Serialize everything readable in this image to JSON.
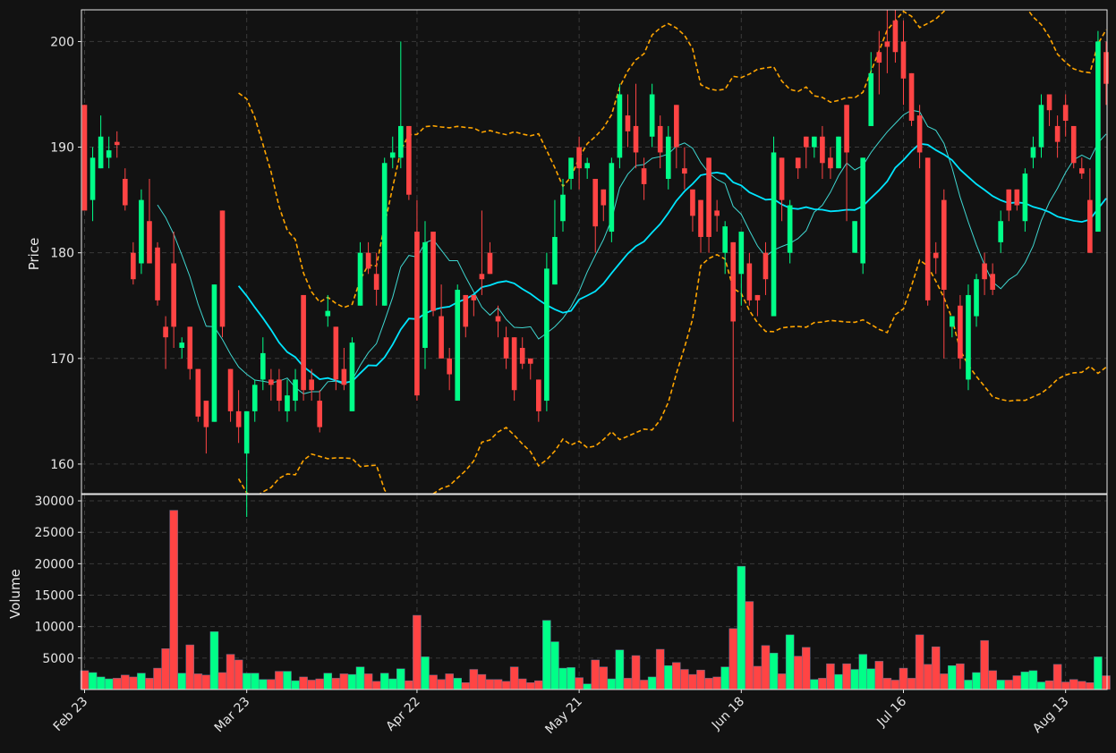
{
  "chart_data": {
    "type": "candlestick",
    "ylabel_price": "Price",
    "ylabel_volume": "Volume",
    "price_ylim": [
      157.2,
      203.0
    ],
    "price_ticks": [
      160,
      170,
      180,
      190,
      200
    ],
    "volume_ylim": [
      0,
      31000
    ],
    "volume_ticks": [
      5000,
      10000,
      15000,
      20000,
      25000,
      30000
    ],
    "x_tick_labels": [
      "Feb 23",
      "Mar 23",
      "Apr 22",
      "May 21",
      "Jun 18",
      "Jul 16",
      "Aug 13"
    ],
    "x_tick_index": [
      0,
      20,
      41,
      61,
      81,
      101,
      121
    ],
    "grid": true,
    "colors": {
      "background": "#121212",
      "up": "#00ff88",
      "down": "#ff4444",
      "sma20": "#00e5ff",
      "sma10": "#3fd6d0",
      "bollinger": "#ffa500",
      "grid": "#3a3a3a",
      "frame": "#e6e6e6"
    },
    "candles": [
      [
        194,
        184,
        194,
        184,
        3000
      ],
      [
        185,
        189,
        190,
        183,
        2700
      ],
      [
        188,
        191,
        193,
        188,
        2000
      ],
      [
        189,
        189.7,
        191,
        188,
        1700
      ],
      [
        190.5,
        190.2,
        191.5,
        189,
        1800
      ],
      [
        187,
        184.5,
        188,
        184,
        2300
      ],
      [
        180,
        177.5,
        181,
        177,
        2000
      ],
      [
        179,
        185,
        186,
        178,
        2600
      ],
      [
        183,
        179,
        187,
        179,
        1800
      ],
      [
        180.5,
        175.5,
        181,
        175,
        3400
      ],
      [
        173,
        172,
        174,
        169,
        6500
      ],
      [
        179,
        173,
        182,
        171,
        28500
      ],
      [
        171,
        171.5,
        172,
        170,
        2600
      ],
      [
        173,
        169,
        173,
        168,
        7100
      ],
      [
        169,
        164.5,
        169,
        164,
        2500
      ],
      [
        166,
        163.5,
        166,
        161,
        2300
      ],
      [
        164,
        177,
        177,
        164,
        9200
      ],
      [
        184,
        173,
        184,
        172,
        2700
      ],
      [
        169,
        165,
        169,
        164,
        5600
      ],
      [
        165,
        163.5,
        167,
        162,
        4700
      ],
      [
        161,
        165,
        165,
        155,
        2600
      ],
      [
        165,
        167.5,
        168,
        164,
        2600
      ],
      [
        168,
        170.5,
        172,
        167,
        1600
      ],
      [
        168,
        167.5,
        169,
        166,
        1600
      ],
      [
        168,
        166,
        169,
        165,
        2900
      ],
      [
        165,
        166.5,
        168,
        164,
        2900
      ],
      [
        166,
        168,
        169,
        165,
        1400
      ],
      [
        176,
        167,
        176,
        166,
        2000
      ],
      [
        168,
        167,
        169,
        166,
        1500
      ],
      [
        166,
        163.5,
        167,
        163,
        1700
      ],
      [
        174,
        174.5,
        176,
        173,
        2600
      ],
      [
        173,
        168,
        173,
        167,
        1800
      ],
      [
        169,
        167.5,
        171,
        167,
        2500
      ],
      [
        165,
        171.5,
        172,
        165,
        2400
      ],
      [
        175,
        180,
        181,
        175,
        3600
      ],
      [
        180,
        178.5,
        181,
        178,
        2500
      ],
      [
        178,
        176.5,
        180,
        175,
        1300
      ],
      [
        175,
        188.5,
        189,
        175,
        2600
      ],
      [
        189,
        189.5,
        191,
        188,
        1700
      ],
      [
        189,
        192,
        200,
        188,
        3300
      ],
      [
        192,
        185.5,
        192,
        185,
        1400
      ],
      [
        182,
        166.5,
        185,
        166,
        11800
      ],
      [
        171,
        181,
        183,
        169,
        5200
      ],
      [
        182,
        174.5,
        182,
        174,
        2300
      ],
      [
        174,
        170,
        177,
        170,
        1600
      ],
      [
        170,
        168.5,
        171,
        167,
        2500
      ],
      [
        166,
        176.5,
        177,
        166,
        1800
      ],
      [
        176,
        173,
        176,
        172,
        1100
      ],
      [
        176,
        175.5,
        176,
        174,
        3200
      ],
      [
        178,
        177.5,
        184,
        176,
        2400
      ],
      [
        180,
        178,
        181,
        178,
        1600
      ],
      [
        174,
        173.5,
        175,
        172,
        1600
      ],
      [
        172,
        170,
        173,
        169,
        1300
      ],
      [
        172,
        167,
        172,
        166,
        3600
      ],
      [
        171,
        169.5,
        172,
        169,
        1700
      ],
      [
        170,
        169.5,
        170,
        168,
        1100
      ],
      [
        168,
        165,
        168,
        164,
        1400
      ],
      [
        166,
        178.5,
        180,
        165,
        11000
      ],
      [
        177,
        181.5,
        185,
        177,
        7600
      ],
      [
        183,
        185.5,
        187,
        182,
        3400
      ],
      [
        187,
        189,
        189,
        186,
        3500
      ],
      [
        190,
        188,
        191,
        186,
        1900
      ],
      [
        188,
        188.5,
        189,
        187,
        900
      ],
      [
        187,
        182.5,
        187,
        180,
        4700
      ],
      [
        186,
        184.5,
        186,
        183,
        3600
      ],
      [
        182,
        188.5,
        189,
        181,
        1700
      ],
      [
        189,
        195,
        196,
        188,
        6300
      ],
      [
        193,
        191.5,
        195,
        190,
        1800
      ],
      [
        192,
        189.5,
        196,
        188,
        5400
      ],
      [
        188,
        186.5,
        189,
        185,
        1500
      ],
      [
        191,
        195,
        196,
        190,
        2000
      ],
      [
        192,
        189.5,
        193,
        188,
        6400
      ],
      [
        187,
        191,
        192,
        186,
        3800
      ],
      [
        194,
        190,
        194,
        188,
        4300
      ],
      [
        188,
        187.5,
        190,
        186,
        3200
      ],
      [
        186,
        183.5,
        186,
        182,
        2400
      ],
      [
        185,
        181.5,
        185,
        180,
        3100
      ],
      [
        189,
        181.5,
        189,
        180,
        1800
      ],
      [
        184,
        183.5,
        185,
        182,
        2000
      ],
      [
        180,
        182.5,
        183,
        178,
        3600
      ],
      [
        181,
        173.5,
        181,
        164,
        9700
      ],
      [
        178,
        182,
        182,
        175,
        19600
      ],
      [
        179,
        175.5,
        180,
        175,
        14000
      ],
      [
        176,
        175.5,
        176,
        174,
        3700
      ],
      [
        180,
        177.5,
        181,
        176,
        7000
      ],
      [
        174,
        189.5,
        191,
        174,
        5800
      ],
      [
        189,
        185,
        189,
        183,
        2500
      ],
      [
        180,
        184.5,
        185,
        179,
        8700
      ],
      [
        189,
        188,
        189,
        187,
        5300
      ],
      [
        191,
        190,
        191,
        188,
        6700
      ],
      [
        190,
        191,
        191,
        189,
        1600
      ],
      [
        191,
        188.5,
        192,
        187,
        1800
      ],
      [
        189,
        188,
        190,
        187,
        4100
      ],
      [
        188,
        191,
        191,
        188,
        2400
      ],
      [
        194,
        189.5,
        194,
        183,
        4100
      ],
      [
        180,
        183,
        183,
        180,
        3200
      ],
      [
        179,
        189,
        189,
        178,
        5600
      ],
      [
        192,
        197,
        199,
        192,
        3300
      ],
      [
        199,
        198,
        201,
        195,
        4500
      ],
      [
        200,
        199.5,
        203,
        197,
        1800
      ],
      [
        202,
        199,
        203,
        198,
        1500
      ],
      [
        200,
        196.5,
        202,
        194,
        3400
      ],
      [
        197,
        192.5,
        197,
        192,
        1800
      ],
      [
        193,
        189.5,
        194,
        188,
        8700
      ],
      [
        189,
        175.5,
        189,
        175,
        4000
      ],
      [
        180,
        179.5,
        181,
        178,
        6800
      ],
      [
        185,
        176.5,
        186,
        170,
        2500
      ],
      [
        173,
        174,
        174,
        172,
        3800
      ],
      [
        175,
        170,
        176,
        169,
        4100
      ],
      [
        168,
        176,
        177,
        167,
        1500
      ],
      [
        174,
        177.5,
        178,
        173,
        2700
      ],
      [
        179,
        177.5,
        180,
        176,
        7800
      ],
      [
        178,
        176.5,
        179,
        176,
        3000
      ],
      [
        181,
        183,
        184,
        180,
        1500
      ],
      [
        186,
        184,
        186,
        183,
        1500
      ],
      [
        186,
        184.5,
        186,
        184,
        2200
      ],
      [
        183,
        187.5,
        188,
        182,
        2800
      ],
      [
        189,
        190,
        191,
        188,
        3000
      ],
      [
        190,
        194,
        195,
        189,
        1200
      ],
      [
        195,
        193.5,
        195,
        192,
        1400
      ],
      [
        192,
        190.5,
        193,
        189,
        4000
      ],
      [
        194,
        192.5,
        195,
        191,
        1200
      ],
      [
        192,
        188.5,
        192,
        188,
        1600
      ],
      [
        188,
        187.5,
        189,
        187,
        1300
      ],
      [
        185,
        180,
        188,
        180,
        1100
      ],
      [
        182,
        200,
        201,
        182,
        5200
      ],
      [
        199,
        196,
        200,
        194,
        2200
      ]
    ]
  }
}
